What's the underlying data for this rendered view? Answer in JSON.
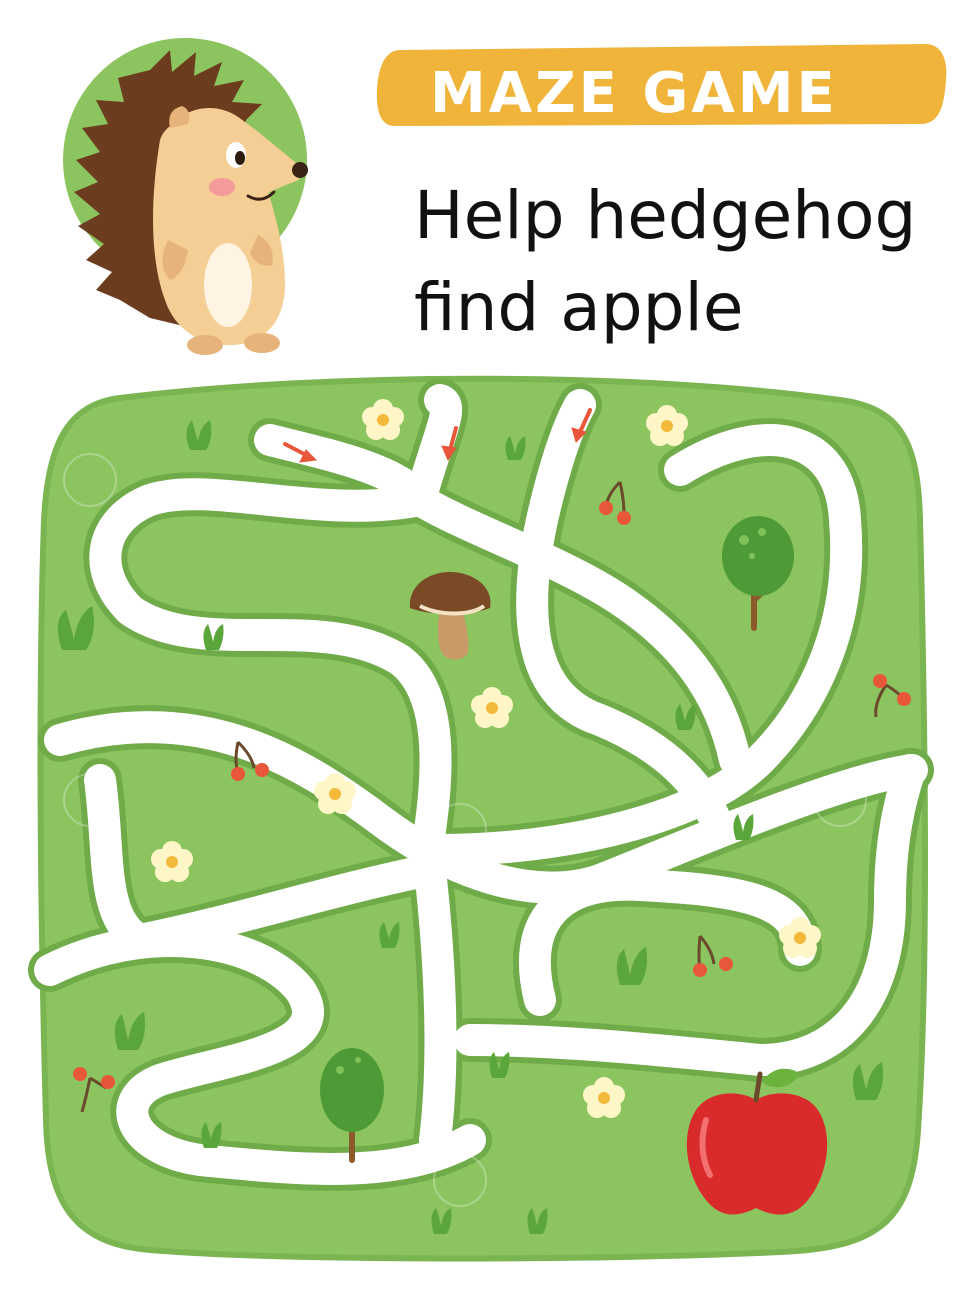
{
  "header": {
    "banner_label": "MAZE GAME",
    "title_line1": "Help hedgehog",
    "title_line2": "find apple"
  },
  "colors": {
    "banner": "#F0B43A",
    "maze_field": "#8CC460",
    "maze_border": "#7AB552",
    "path": "#FFFFFF",
    "arrow": "#E8573A",
    "apple": "#D92B2B",
    "hedgehog_body": "#F4CE94",
    "hedgehog_spines": "#6B3C1E",
    "badge": "#8CC460"
  },
  "maze": {
    "entrances": [
      "entrance-arrow-left",
      "entrance-arrow-middle",
      "entrance-arrow-right"
    ],
    "goal": "apple-icon"
  }
}
